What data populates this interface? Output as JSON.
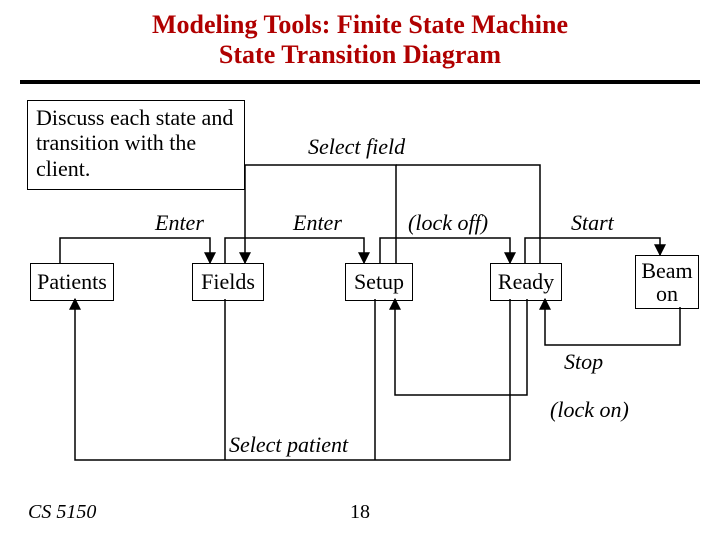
{
  "title_line1": "Modeling Tools: Finite State Machine",
  "title_line2": "State Transition Diagram",
  "note": "Discuss each state and transition with the client.",
  "labels": {
    "select_field": "Select field",
    "enter1": "Enter",
    "enter2": "Enter",
    "lock_off": "(lock off)",
    "start": "Start",
    "stop": "Stop",
    "lock_on": "(lock on)",
    "select_patient": "Select patient"
  },
  "states": {
    "patients": "Patients",
    "fields": "Fields",
    "setup": "Setup",
    "ready": "Ready",
    "beam_on": "Beam\non"
  },
  "footer": {
    "course": "CS 5150",
    "page": "18"
  },
  "diagram_data": {
    "type": "state_transition_diagram",
    "states": [
      "Patients",
      "Fields",
      "Setup",
      "Ready",
      "Beam on"
    ],
    "transitions": [
      {
        "from": "Patients",
        "to": "Fields",
        "label": "Enter"
      },
      {
        "from": "Fields",
        "to": "Setup",
        "label": "Enter"
      },
      {
        "from": "Setup",
        "to": "Ready",
        "label": "(lock off)"
      },
      {
        "from": "Ready",
        "to": "Beam on",
        "label": "Start"
      },
      {
        "from": "Beam on",
        "to": "Ready",
        "label": "Stop"
      },
      {
        "from": "Ready",
        "to": "Setup",
        "label": "(lock on)"
      },
      {
        "from": "Setup",
        "to": "Fields",
        "label": "Select field"
      },
      {
        "from": "Fields",
        "to": "Patients",
        "label": "Select patient"
      },
      {
        "from": "Setup",
        "to": "Patients",
        "label": "Select patient"
      },
      {
        "from": "Ready",
        "to": "Patients",
        "label": "Select patient"
      },
      {
        "from": "Ready",
        "to": "Fields",
        "label": "Select field"
      }
    ]
  }
}
